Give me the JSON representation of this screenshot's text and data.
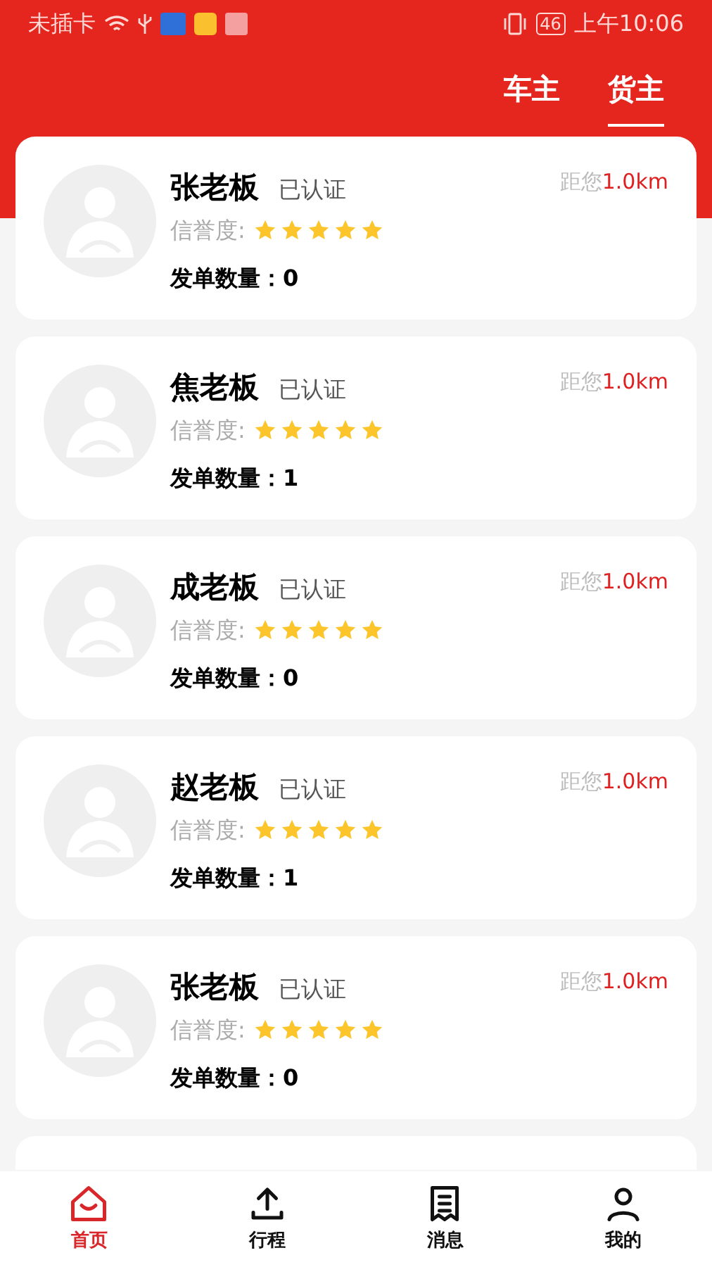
{
  "status_bar": {
    "carrier": "未插卡",
    "battery": "46",
    "time": "上午10:06"
  },
  "tabs": [
    {
      "label": "车主",
      "selected": false
    },
    {
      "label": "货主",
      "selected": true
    }
  ],
  "cards": [
    {
      "name": "张老板",
      "verified": "已认证",
      "credit_label": "信誉度:",
      "stars": 5,
      "orders": "发单数量：0",
      "distance_label": "距您",
      "distance": "1.0km"
    },
    {
      "name": "焦老板",
      "verified": "已认证",
      "credit_label": "信誉度:",
      "stars": 5,
      "orders": "发单数量：1",
      "distance_label": "距您",
      "distance": "1.0km"
    },
    {
      "name": "成老板",
      "verified": "已认证",
      "credit_label": "信誉度:",
      "stars": 5,
      "orders": "发单数量：0",
      "distance_label": "距您",
      "distance": "1.0km"
    },
    {
      "name": "赵老板",
      "verified": "已认证",
      "credit_label": "信誉度:",
      "stars": 5,
      "orders": "发单数量：1",
      "distance_label": "距您",
      "distance": "1.0km"
    },
    {
      "name": "张老板",
      "verified": "已认证",
      "credit_label": "信誉度:",
      "stars": 5,
      "orders": "发单数量：0",
      "distance_label": "距您",
      "distance": "1.0km"
    }
  ],
  "nav": [
    {
      "label": "首页",
      "kind": "home",
      "selected": true
    },
    {
      "label": "行程",
      "kind": "upload",
      "selected": false
    },
    {
      "label": "消息",
      "kind": "receipt",
      "selected": false
    },
    {
      "label": "我的",
      "kind": "person",
      "selected": false
    }
  ]
}
